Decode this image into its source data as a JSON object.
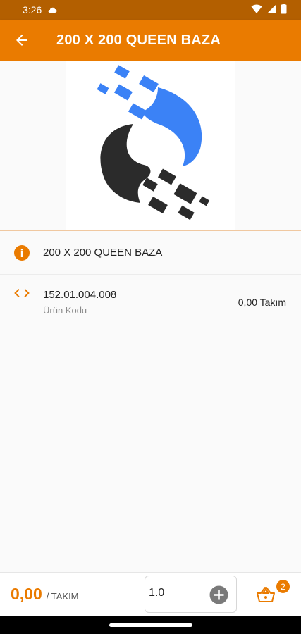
{
  "status_bar": {
    "time": "3:26"
  },
  "header": {
    "title": "200 X 200 QUEEN BAZA"
  },
  "product": {
    "name": "200 X 200 QUEEN BAZA",
    "code": "152.01.004.008",
    "code_label": "Ürün Kodu",
    "price": "0,00 Takım"
  },
  "bottom": {
    "total": "0,00",
    "unit": "/ TAKIM",
    "quantity": "1.0",
    "cart_count": "2"
  },
  "colors": {
    "accent": "#ea7b00",
    "status_bar": "#b35f00",
    "logo_blue": "#3b82f6",
    "logo_dark": "#2b2b2b"
  }
}
